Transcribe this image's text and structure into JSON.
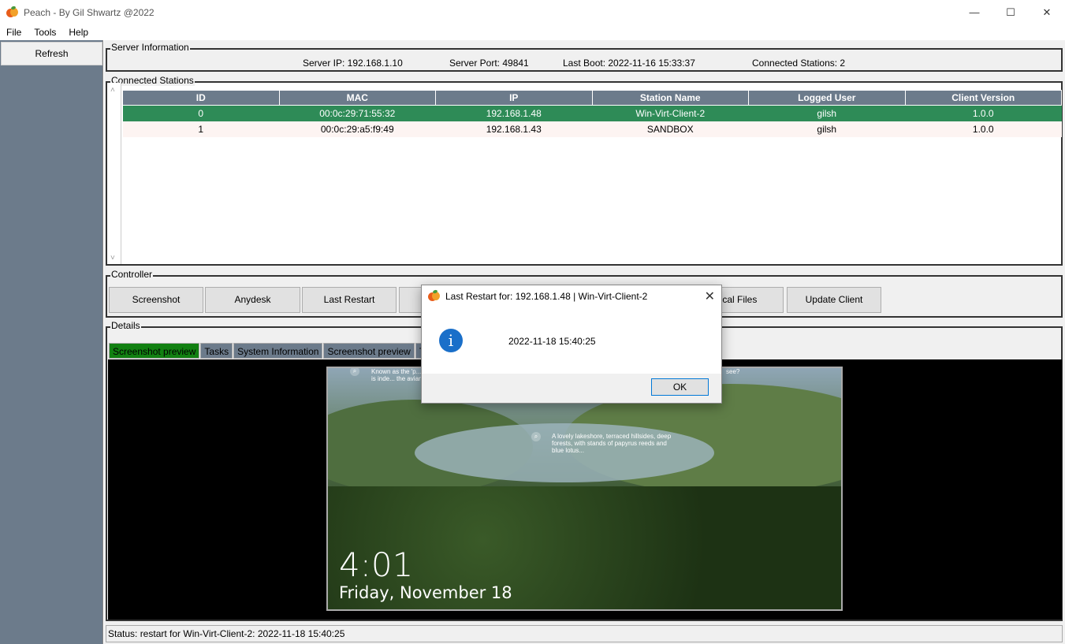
{
  "window": {
    "title": "Peach - By Gil Shwartz @2022",
    "minimize": "—",
    "maximize": "☐",
    "close": "✕"
  },
  "menu": [
    "File",
    "Tools",
    "Help"
  ],
  "sidebar": {
    "refresh_label": "Refresh"
  },
  "server_info": {
    "group_title": "Server Information",
    "ip": "Server IP: 192.168.1.10",
    "port": "Server Port: 49841",
    "last_boot": "Last Boot: 2022-11-16 15:33:37",
    "connected": "Connected Stations: 2"
  },
  "stations": {
    "group_title": "Connected Stations",
    "columns": [
      "ID",
      "MAC",
      "IP",
      "Station Name",
      "Logged User",
      "Client Version"
    ],
    "rows": [
      [
        "0",
        "00:0c:29:71:55:32",
        "192.168.1.48",
        "Win-Virt-Client-2",
        "gilsh",
        "1.0.0"
      ],
      [
        "1",
        "00:0c:29:a5:f9:49",
        "192.168.1.43",
        "SANDBOX",
        "gilsh",
        "1.0.0"
      ]
    ],
    "selected_row_color": "#2e8b57",
    "header_color": "#6c7b8b"
  },
  "controller": {
    "group_title": "Controller",
    "buttons": [
      "Screenshot",
      "Anydesk",
      "Last Restart",
      "",
      "ocal Files",
      "Update Client"
    ]
  },
  "details": {
    "group_title": "Details",
    "tabs": [
      "Screenshot preview",
      "Tasks",
      "System Information",
      "Screenshot preview",
      "T"
    ],
    "active_tab_color": "#118011"
  },
  "lockscreen": {
    "time": "4:01",
    "date": "Friday, November 18",
    "caption_top": "Known as the 'p... this lake is inde... the avian crowd",
    "caption_mid": "A lovely lakeshore, terraced hillsides, deep forests, with stands of papyrus reeds and blue lotus...",
    "caption_right": "see?"
  },
  "status": {
    "text": "Status: restart for Win-Virt-Client-2: 2022-11-18 15:40:25"
  },
  "dialog": {
    "title": "Last Restart for: 192.168.1.48 | Win-Virt-Client-2",
    "message": "2022-11-18 15:40:25",
    "ok_label": "OK",
    "close": "✕",
    "info_glyph": "i"
  }
}
